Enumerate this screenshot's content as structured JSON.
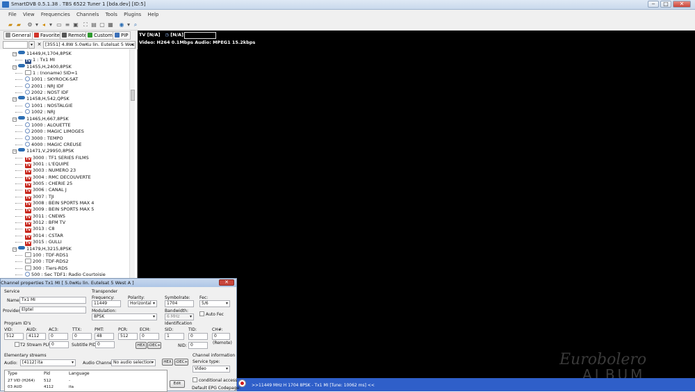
{
  "window": {
    "title": "SmartDVB 0.5.1.38 . TBS 6522 Tuner 1 [bda.dev] [ID:5]",
    "buttons": [
      "‒",
      "□",
      "✕"
    ]
  },
  "menu": [
    "File",
    "View",
    "Frequencies",
    "Channels",
    "Tools",
    "Plugins",
    "Help"
  ],
  "tabs": [
    {
      "label": "General",
      "color": "#8a8a8a"
    },
    {
      "label": "Favorites",
      "color": "#d2342a"
    },
    {
      "label": "Remote",
      "color": "#555555"
    },
    {
      "label": "Custom",
      "color": "#2e9a2e"
    },
    {
      "label": "PIP",
      "color": "#3a6fb8"
    }
  ],
  "filter": {
    "satellite": "[3551] 4.8W  5.0wKu lin. Eutelsat 5 West"
  },
  "tree": [
    {
      "kind": "tp",
      "text": "11449,H,1704,8PSK"
    },
    {
      "kind": "ch",
      "icon": "tvf",
      "text": "1 : Tx1 MI"
    },
    {
      "kind": "tp",
      "text": "11455,H,2400,8PSK"
    },
    {
      "kind": "ch",
      "icon": "data",
      "text": "1 : (noname) SID=1"
    },
    {
      "kind": "ch",
      "icon": "radio",
      "text": "1001 : SKYROCK-SAT"
    },
    {
      "kind": "ch",
      "icon": "radio",
      "text": "2001 : NRJ IDF"
    },
    {
      "kind": "ch",
      "icon": "radio",
      "text": "2002 : NOST IDF"
    },
    {
      "kind": "tp",
      "text": "11458,H,542,QPSK"
    },
    {
      "kind": "ch",
      "icon": "radio",
      "text": "1001 : NOSTALGIE"
    },
    {
      "kind": "ch",
      "icon": "radio",
      "text": "1002 : NRJ"
    },
    {
      "kind": "tp",
      "text": "11465,H,667,8PSK"
    },
    {
      "kind": "ch",
      "icon": "radio",
      "text": "1000 : ALOUETTE"
    },
    {
      "kind": "ch",
      "icon": "radio",
      "text": "2000 : MAGIC LIMOGES"
    },
    {
      "kind": "ch",
      "icon": "radio",
      "text": "3000 : TEMPO"
    },
    {
      "kind": "ch",
      "icon": "radio",
      "text": "4000 : MAGIC CREUSE"
    },
    {
      "kind": "tp",
      "text": "11471,V,29950,8PSK"
    },
    {
      "kind": "ch",
      "icon": "tvs",
      "text": "3000 : TF1 SERIES FILMS"
    },
    {
      "kind": "ch",
      "icon": "tvs",
      "text": "3001 : L'EQUIPE"
    },
    {
      "kind": "ch",
      "icon": "tvs",
      "text": "3003 : NUMERO 23"
    },
    {
      "kind": "ch",
      "icon": "tvs",
      "text": "3004 : RMC DECOUVERTE"
    },
    {
      "kind": "ch",
      "icon": "tvs",
      "text": "3005 : CHERIE 25"
    },
    {
      "kind": "ch",
      "icon": "tvs",
      "text": "3006 : CANAL J"
    },
    {
      "kind": "ch",
      "icon": "tvs",
      "text": "3007 : TJI"
    },
    {
      "kind": "ch",
      "icon": "tvs",
      "text": "3008 : BEIN SPORTS MAX 4"
    },
    {
      "kind": "ch",
      "icon": "tvs",
      "text": "3009 : BEIN SPORTS MAX 5"
    },
    {
      "kind": "ch",
      "icon": "tvs",
      "text": "3011 : CNEWS"
    },
    {
      "kind": "ch",
      "icon": "tvs",
      "text": "3012 : BFM TV"
    },
    {
      "kind": "ch",
      "icon": "tvs",
      "text": "3013 : C8"
    },
    {
      "kind": "ch",
      "icon": "tvs",
      "text": "3014 : CSTAR"
    },
    {
      "kind": "ch",
      "icon": "tvs",
      "text": "3015 : GULLI"
    },
    {
      "kind": "tp",
      "text": "11479,H,3215,8PSK"
    },
    {
      "kind": "ch",
      "icon": "data",
      "text": "100 : TDF-RDS1"
    },
    {
      "kind": "ch",
      "icon": "data",
      "text": "200 : TDF-RDS2"
    },
    {
      "kind": "ch",
      "icon": "data",
      "text": "300 : Tiers-RDS"
    },
    {
      "kind": "ch",
      "icon": "radio",
      "text": "500 : Sec TDF1: Radio Courtoisie"
    }
  ],
  "video": {
    "line1_tv": "TV",
    "line1_a": "[N/A]",
    "line1_b": "[N/A]",
    "line2": "Video: H264    0.1Mbps    Audio: MPEG1   15.2kbps"
  },
  "watermark": {
    "line1": "Eurobolero",
    "line2": "ALBUM"
  },
  "status": {
    "text": ">>11449 MHz H 1704 8PSK - Tx1 MI [Tune: 10062 ms] <<",
    "bar_color": "#2f5fc9"
  },
  "dialog": {
    "title": "Channel properties Tx1 MI [ 5.0wKu lin. Eutelsat 5 West A ]",
    "service": {
      "section": "Service",
      "name_label": "Name:",
      "name": "Tx1 MI",
      "provider_label": "Provider:",
      "provider": "Elptel"
    },
    "transponder": {
      "section": "Transponder",
      "frequency_label": "Frequency:",
      "frequency": "11449",
      "polarity_label": "Polarity:",
      "polarity": "Horizontal",
      "symbolrate_label": "Symbolrate:",
      "symbolrate": "1704",
      "fec_label": "Fec:",
      "fec": "5/6",
      "modulation_label": "Modulation:",
      "modulation": "8PSK",
      "bandwidth_label": "Bandwidth:",
      "bandwidth": "6 MHz",
      "autofec_label": "Auto Fec"
    },
    "pids": {
      "section": "Program ID's",
      "labels": [
        "VID:",
        "AUD:",
        "AC3:",
        "TTX:",
        "PMT:",
        "PCR:",
        "ECM:"
      ],
      "values": [
        "512",
        "4112",
        "0",
        "0",
        "48",
        "512",
        "0"
      ],
      "t2_label": "T2 Stream PLP :",
      "t2": "0",
      "subtitle_label": "Subtitle PID:",
      "subtitle": "0",
      "hex": "HEX",
      "dec": "-DEC+"
    },
    "identification": {
      "section": "Identification",
      "sid_label": "SID:",
      "sid": "1",
      "tid_label": "TID:",
      "tid": "0",
      "ch_label": "CH#:",
      "ch": "0",
      "remote": "(Remote)",
      "nid_label": "NID:",
      "nid": "0"
    },
    "elementary": {
      "section": "Elementary streams",
      "audio_label": "Audio:",
      "audio": "[4112] ita",
      "audio_channel_label": "Audio Channel:",
      "audio_channel": "No audio selection",
      "hex": "HEX",
      "dec": "-DEC+",
      "columns": [
        "Type",
        "Pid",
        "Language"
      ],
      "rows": [
        [
          "27 VID (H264)",
          "512",
          "-"
        ],
        [
          "03 AUD",
          "4112",
          "ita"
        ]
      ],
      "edit": "Edit"
    },
    "channel_info": {
      "section": "Channel information",
      "service_type_label": "Service type:",
      "service_type": "Video",
      "conditional_label": "conditional access",
      "epg_label": "Default EPG Codepage:"
    }
  }
}
